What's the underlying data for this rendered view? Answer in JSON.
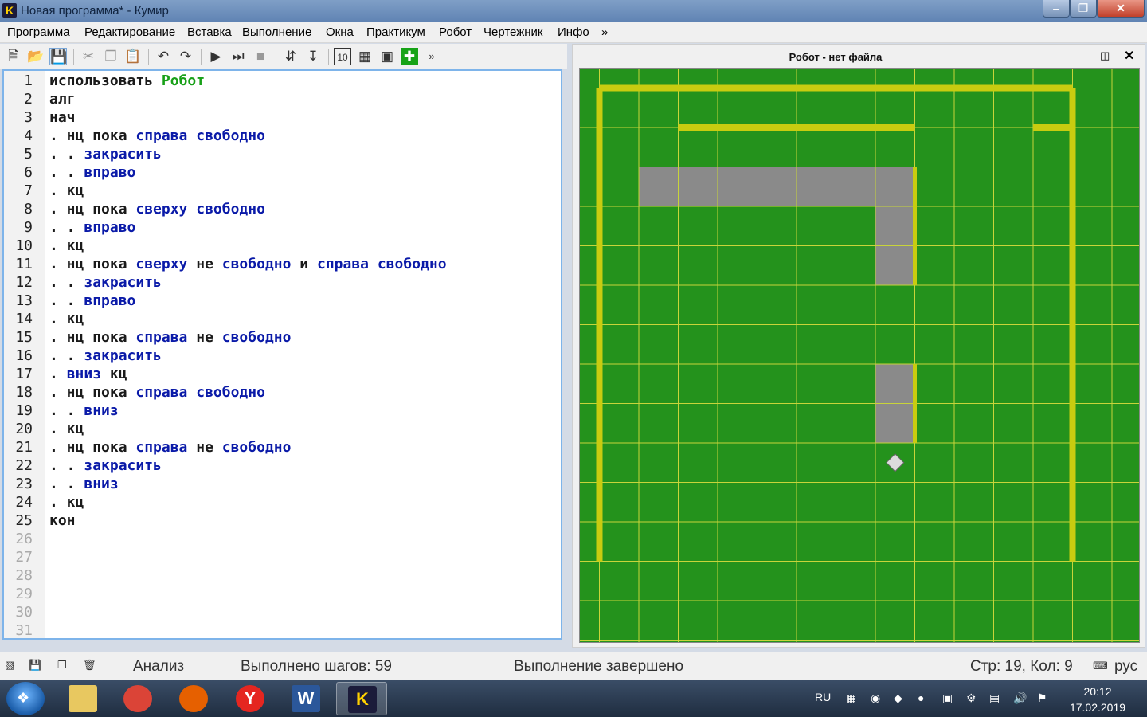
{
  "window": {
    "app_icon": "K",
    "title": "Новая программа* - Кумир",
    "minimize": "–",
    "maximize": "❐",
    "close": "✕"
  },
  "menu": {
    "items": [
      "Программа",
      "Редактирование",
      "Вставка",
      "Выполнение",
      "Окна",
      "Практикум",
      "Робот",
      "Чертежник",
      "Инфо",
      "»"
    ]
  },
  "toolbar": {
    "more": "»"
  },
  "editor": {
    "line_numbers": [
      "1",
      "2",
      "3",
      "4",
      "5",
      "6",
      "7",
      "8",
      "9",
      "10",
      "11",
      "12",
      "13",
      "14",
      "15",
      "16",
      "17",
      "18",
      "19",
      "20",
      "21",
      "22",
      "23",
      "24",
      "25",
      "26",
      "27",
      "28",
      "29",
      "30",
      "31"
    ],
    "lines": [
      [
        {
          "t": "использовать ",
          "c": "kw"
        },
        {
          "t": "Робот",
          "c": "mod"
        }
      ],
      [
        {
          "t": "алг",
          "c": "kw"
        }
      ],
      [
        {
          "t": "нач",
          "c": "kw"
        }
      ],
      [
        {
          "t": ". нц пока ",
          "c": "kw"
        },
        {
          "t": "справа свободно",
          "c": "fn"
        }
      ],
      [
        {
          "t": ". . ",
          "c": "kw"
        },
        {
          "t": "закрасить",
          "c": "fn"
        }
      ],
      [
        {
          "t": ". . ",
          "c": "kw"
        },
        {
          "t": "вправо",
          "c": "fn"
        }
      ],
      [
        {
          "t": ". кц",
          "c": "kw"
        }
      ],
      [
        {
          "t": ". нц пока ",
          "c": "kw"
        },
        {
          "t": "сверху свободно",
          "c": "fn"
        }
      ],
      [
        {
          "t": ". . ",
          "c": "kw"
        },
        {
          "t": "вправо",
          "c": "fn"
        }
      ],
      [
        {
          "t": ". кц",
          "c": "kw"
        }
      ],
      [
        {
          "t": ". нц пока ",
          "c": "kw"
        },
        {
          "t": "сверху ",
          "c": "fn"
        },
        {
          "t": "не ",
          "c": "kw"
        },
        {
          "t": "свободно ",
          "c": "fn"
        },
        {
          "t": "и ",
          "c": "kw"
        },
        {
          "t": "справа свободно",
          "c": "fn"
        }
      ],
      [
        {
          "t": ". . ",
          "c": "kw"
        },
        {
          "t": "закрасить",
          "c": "fn"
        }
      ],
      [
        {
          "t": ". . ",
          "c": "kw"
        },
        {
          "t": "вправо",
          "c": "fn"
        }
      ],
      [
        {
          "t": ". кц",
          "c": "kw"
        }
      ],
      [
        {
          "t": ". нц пока ",
          "c": "kw"
        },
        {
          "t": "справа ",
          "c": "fn"
        },
        {
          "t": "не ",
          "c": "kw"
        },
        {
          "t": "свободно",
          "c": "fn"
        }
      ],
      [
        {
          "t": ". . ",
          "c": "kw"
        },
        {
          "t": "закрасить",
          "c": "fn"
        }
      ],
      [
        {
          "t": ". ",
          "c": "kw"
        },
        {
          "t": "вниз ",
          "c": "fn"
        },
        {
          "t": "кц",
          "c": "kw"
        }
      ],
      [
        {
          "t": ". нц пока ",
          "c": "kw"
        },
        {
          "t": "справа свободно",
          "c": "fn"
        }
      ],
      [
        {
          "t": ". . ",
          "c": "kw"
        },
        {
          "t": "вниз",
          "c": "fn"
        }
      ],
      [
        {
          "t": ". кц",
          "c": "kw"
        }
      ],
      [
        {
          "t": ". нц пока ",
          "c": "kw"
        },
        {
          "t": "справа ",
          "c": "fn"
        },
        {
          "t": "не ",
          "c": "kw"
        },
        {
          "t": "свободно",
          "c": "fn"
        }
      ],
      [
        {
          "t": ". . ",
          "c": "kw"
        },
        {
          "t": "закрасить",
          "c": "fn"
        }
      ],
      [
        {
          "t": ". . ",
          "c": "kw"
        },
        {
          "t": "вниз",
          "c": "fn"
        }
      ],
      [
        {
          "t": ". кц",
          "c": "kw"
        }
      ],
      [
        {
          "t": "кон",
          "c": "kw"
        }
      ]
    ]
  },
  "robot_panel": {
    "title": "Робот - нет файла",
    "float_icon": "◫",
    "close": "✕",
    "field": {
      "cols": 14,
      "rows": 14,
      "colors": {
        "background": "#24921c",
        "grid": "#c8d43a",
        "wall": "#c8cc10",
        "painted": "#8a8a8a",
        "robot": "#dcdcdc"
      },
      "painted_cells": [
        [
          2,
          3
        ],
        [
          3,
          3
        ],
        [
          4,
          3
        ],
        [
          5,
          3
        ],
        [
          6,
          3
        ],
        [
          7,
          3
        ],
        [
          8,
          3
        ],
        [
          8,
          4
        ],
        [
          8,
          5
        ],
        [
          8,
          8
        ],
        [
          8,
          9
        ]
      ],
      "walls_h": [
        [
          1,
          1,
          13,
          "top"
        ],
        [
          1,
          12,
          13,
          "bottom"
        ],
        [
          2,
          3,
          8,
          "top"
        ]
      ],
      "walls_v": [
        [
          1,
          1,
          12,
          "left"
        ],
        [
          12,
          1,
          12,
          "right"
        ],
        [
          8,
          3,
          5,
          "right"
        ],
        [
          8,
          8,
          9,
          "right"
        ]
      ],
      "robot_cell": [
        8,
        10
      ]
    }
  },
  "status": {
    "analysis": "Анализ",
    "steps": "Выполнено шагов: 59",
    "state": "Выполнение завершено",
    "cursor": "Стр: 19, Кол: 9",
    "lang": "рус"
  },
  "taskbar": {
    "start_icon": "windows-orb",
    "apps": [
      {
        "name": "explorer",
        "label": "",
        "color": "#e8c860"
      },
      {
        "name": "chrome",
        "label": "",
        "color": "#db4437"
      },
      {
        "name": "firefox",
        "label": "",
        "color": "#e66000"
      },
      {
        "name": "yandex",
        "label": "Y",
        "color": "#e52620"
      },
      {
        "name": "word",
        "label": "W",
        "color": "#2b579a"
      },
      {
        "name": "kumir",
        "label": "K",
        "color": "#1b1b3a"
      }
    ],
    "lang": "RU",
    "time": "20:12",
    "date": "17.02.2019"
  }
}
